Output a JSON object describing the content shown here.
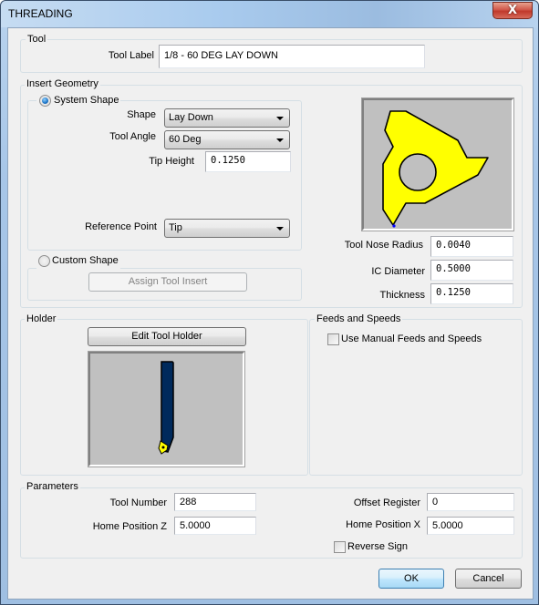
{
  "window": {
    "title": "THREADING",
    "close_glyph": "X"
  },
  "tool": {
    "group_label": "Tool",
    "tool_label_caption": "Tool Label",
    "tool_label_value": "1/8 - 60 DEG LAY DOWN"
  },
  "insert_geometry": {
    "group_label": "Insert Geometry",
    "system_shape": {
      "label": "System Shape",
      "selected": true,
      "shape_caption": "Shape",
      "shape_value": "Lay Down",
      "tool_angle_caption": "Tool Angle",
      "tool_angle_value": "60 Deg",
      "tip_height_caption": "Tip Height",
      "tip_height_value": "0.1250",
      "reference_point_caption": "Reference Point",
      "reference_point_value": "Tip"
    },
    "custom_shape": {
      "label": "Custom Shape",
      "selected": false,
      "assign_button": "Assign Tool Insert"
    },
    "tool_nose_radius_caption": "Tool Nose Radius",
    "tool_nose_radius_value": "0.0040",
    "ic_diameter_caption": "IC Diameter",
    "ic_diameter_value": "0.5000",
    "thickness_caption": "Thickness",
    "thickness_value": "0.1250",
    "preview": {
      "insert_fill": "#ffff00",
      "background": "#c0c0c0",
      "tip_marker_color": "#0000ff"
    }
  },
  "holder": {
    "group_label": "Holder",
    "edit_button": "Edit Tool Holder",
    "preview": {
      "holder_color": "#002a5c",
      "insert_fill": "#ffff00"
    }
  },
  "feeds_speeds": {
    "group_label": "Feeds and Speeds",
    "manual_checkbox_label": "Use Manual Feeds and Speeds",
    "manual_checked": false
  },
  "parameters": {
    "group_label": "Parameters",
    "tool_number_caption": "Tool Number",
    "tool_number_value": "288",
    "home_z_caption": "Home Position Z",
    "home_z_value": "5.0000",
    "offset_register_caption": "Offset Register",
    "offset_register_value": "0",
    "home_x_caption": "Home Position X",
    "home_x_value": "5.0000",
    "reverse_sign_label": "Reverse Sign",
    "reverse_sign_checked": false
  },
  "footer": {
    "ok_button": "OK",
    "cancel_button": "Cancel"
  }
}
